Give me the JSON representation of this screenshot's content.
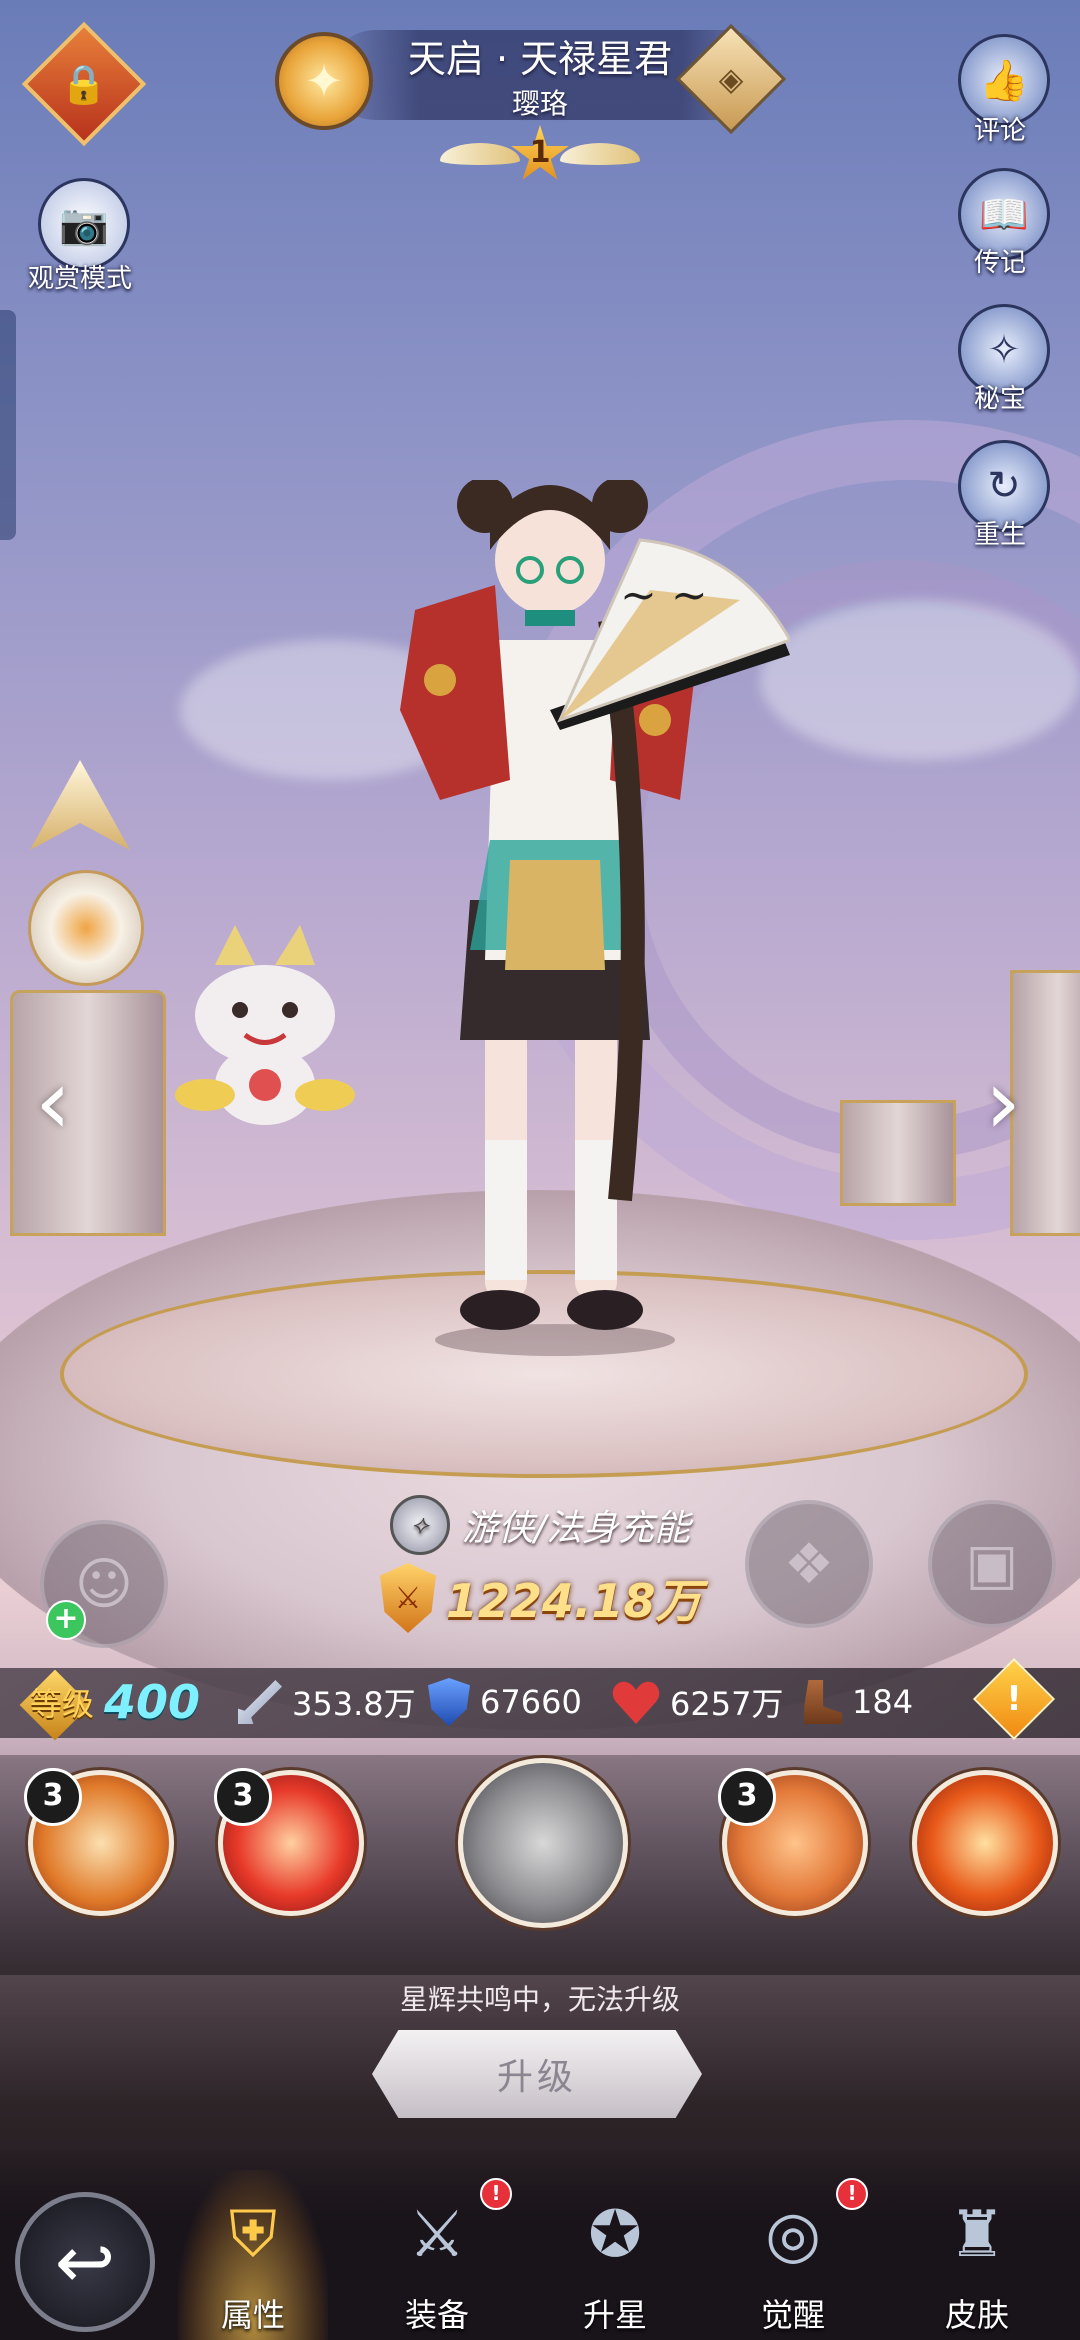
{
  "header": {
    "hero_name": "天启 · 天禄星君",
    "hero_subtitle": "璎珞",
    "star_rank": "1"
  },
  "left_buttons": {
    "lock_icon": "lock-icon",
    "view_mode_label": "观赏模式"
  },
  "right_buttons": [
    {
      "label": "评论",
      "icon": "comment-icon"
    },
    {
      "label": "传记",
      "icon": "biography-icon"
    },
    {
      "label": "秘宝",
      "icon": "treasure-icon"
    },
    {
      "label": "重生",
      "icon": "rebirth-icon"
    }
  ],
  "hero_info": {
    "class_label": "游侠/法身充能",
    "power": "1224.18万"
  },
  "stats": {
    "level_label": "等级",
    "level": "400",
    "attack": "353.8万",
    "defense": "67660",
    "hp": "6257万",
    "speed": "184"
  },
  "skills": [
    {
      "level": "3",
      "icon": "fan-skill-icon"
    },
    {
      "level": "3",
      "icon": "fire-spiral-skill-icon"
    },
    {
      "level": "",
      "icon": "locked-ultimate-skill-icon"
    },
    {
      "level": "3",
      "icon": "beast-skill-icon"
    },
    {
      "level": "",
      "icon": "summon-skill-icon"
    }
  ],
  "notice": "星辉共鸣中，无法升级",
  "upgrade_label": "升级",
  "bottom_nav": [
    {
      "label": "属性",
      "active": true,
      "badge": false
    },
    {
      "label": "装备",
      "active": false,
      "badge": true
    },
    {
      "label": "升星",
      "active": false,
      "badge": false
    },
    {
      "label": "觉醒",
      "active": false,
      "badge": true
    },
    {
      "label": "皮肤",
      "active": false,
      "badge": false
    }
  ],
  "badge_mark": "!",
  "warning_mark": "!",
  "colors": {
    "power_gold": "#ffe08a",
    "level_cyan": "#7ef0ff",
    "badge_red": "#e8303a"
  }
}
